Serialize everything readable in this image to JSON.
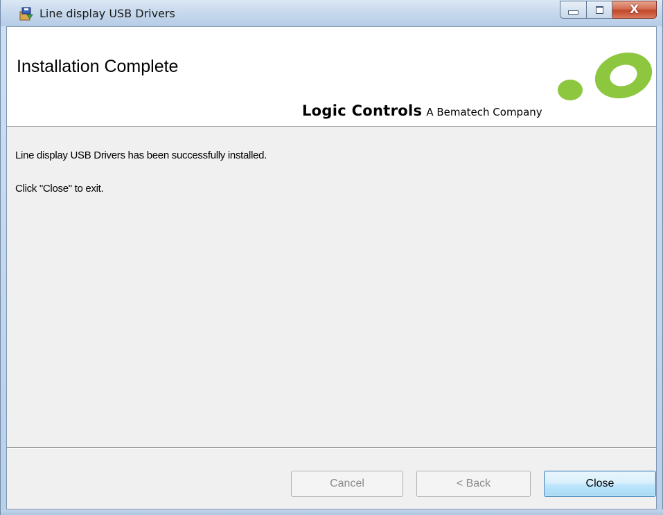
{
  "window": {
    "title": "Line display USB Drivers",
    "title_icon": "installer-icon",
    "caption_buttons": {
      "minimize_icon": "minimize-icon",
      "maximize_icon": "maximize-icon",
      "close_glyph": "X"
    }
  },
  "banner": {
    "title": "Installation Complete",
    "logo_main": "Logic Controls",
    "logo_sub": "A Bematech Company",
    "logo_color": "#8dc63f"
  },
  "body": {
    "line1": "Line display USB Drivers has been successfully installed.",
    "line2": "Click \"Close\" to exit."
  },
  "buttons": {
    "cancel": "Cancel",
    "back": "< Back",
    "close": "Close"
  },
  "colors": {
    "client_background": "#f0f0f0",
    "banner_background": "#ffffff",
    "close_button_accent": "#3c7fb1"
  }
}
